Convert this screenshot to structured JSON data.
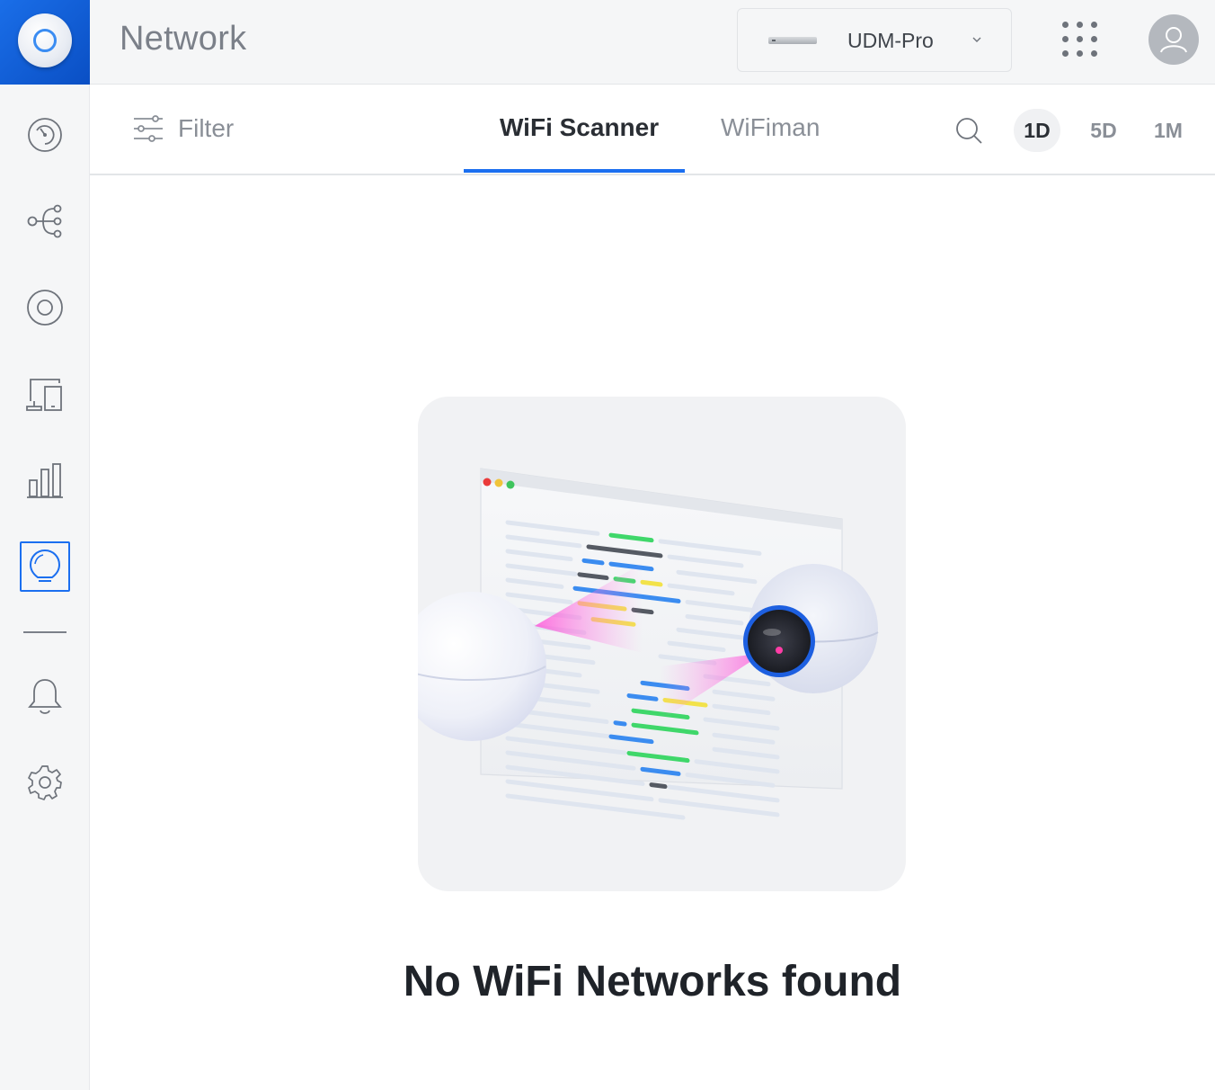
{
  "header": {
    "app_title": "Network",
    "device_selector": {
      "label": "UDM-Pro"
    }
  },
  "sidebar": {
    "items": [
      {
        "icon": "dashboard-icon"
      },
      {
        "icon": "topology-icon"
      },
      {
        "icon": "devices-icon"
      },
      {
        "icon": "clients-icon"
      },
      {
        "icon": "statistics-icon"
      },
      {
        "icon": "insights-icon",
        "active": true
      },
      {
        "icon": "alerts-icon"
      },
      {
        "icon": "settings-icon"
      }
    ]
  },
  "subheader": {
    "filter_label": "Filter",
    "tabs": [
      {
        "label": "WiFi Scanner",
        "active": true
      },
      {
        "label": "WiFiman",
        "active": false
      }
    ],
    "time_ranges": [
      {
        "label": "1D",
        "active": true
      },
      {
        "label": "5D",
        "active": false
      },
      {
        "label": "1M",
        "active": false
      }
    ]
  },
  "main": {
    "empty_message": "No WiFi Networks found"
  },
  "colors": {
    "accent": "#1b6ff0",
    "brand_tile": "#0a4fc4"
  }
}
